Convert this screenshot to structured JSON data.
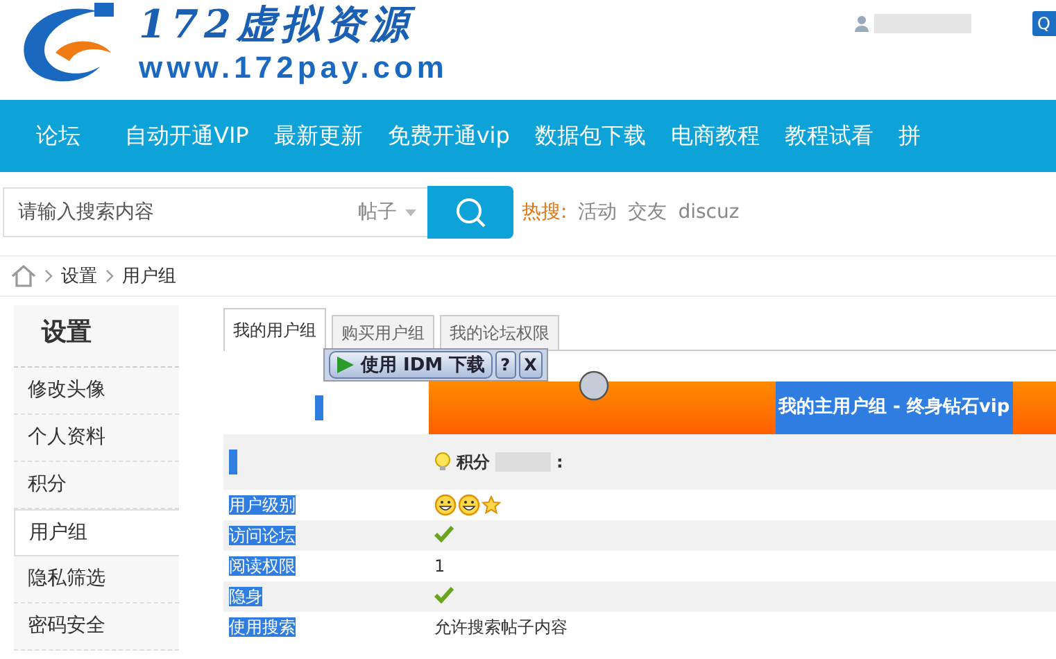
{
  "header": {
    "logo_title": "172虚拟资源",
    "logo_url": "www.172pay.com",
    "login_button": "Q"
  },
  "nav": [
    "论坛",
    "自动开通VIP",
    "最新更新",
    "免费开通vip",
    "数据包下载",
    "电商教程",
    "教程试看",
    "拼"
  ],
  "search": {
    "placeholder": "请输入搜索内容",
    "scope": "帖子",
    "hot_label": "热搜:",
    "hot_terms": [
      "活动",
      "交友",
      "discuz"
    ]
  },
  "breadcrumb": [
    "设置",
    "用户组"
  ],
  "sidebar": {
    "title": "设置",
    "items": [
      {
        "label": "修改头像",
        "selected": false
      },
      {
        "label": "个人资料",
        "selected": false
      },
      {
        "label": "积分",
        "selected": false
      },
      {
        "label": "用户组",
        "selected": true
      },
      {
        "label": "隐私筛选",
        "selected": false
      },
      {
        "label": "密码安全",
        "selected": false
      }
    ]
  },
  "tabs": [
    {
      "label": "我的用户组",
      "selected": true
    },
    {
      "label": "购买用户组",
      "selected": false
    },
    {
      "label": "我的论坛权限",
      "selected": false
    }
  ],
  "download_overlay": {
    "button": "使用 IDM 下载",
    "help": "?",
    "close": "X"
  },
  "table": {
    "title": "我的主用户组 - 终身钻石vip",
    "title_highlighted": true,
    "points_label": "积分",
    "points_suffix": ":",
    "rows": [
      {
        "label": "用户级别",
        "highlighted": true,
        "kind": "level_icons"
      },
      {
        "label": "访问论坛",
        "highlighted": true,
        "kind": "check"
      },
      {
        "label": "阅读权限",
        "highlighted": true,
        "kind": "text",
        "value": "1"
      },
      {
        "label": "隐身",
        "highlighted": true,
        "kind": "check"
      },
      {
        "label": "使用搜索",
        "highlighted": true,
        "kind": "text",
        "value": "允许搜索帖子内容"
      }
    ]
  }
}
